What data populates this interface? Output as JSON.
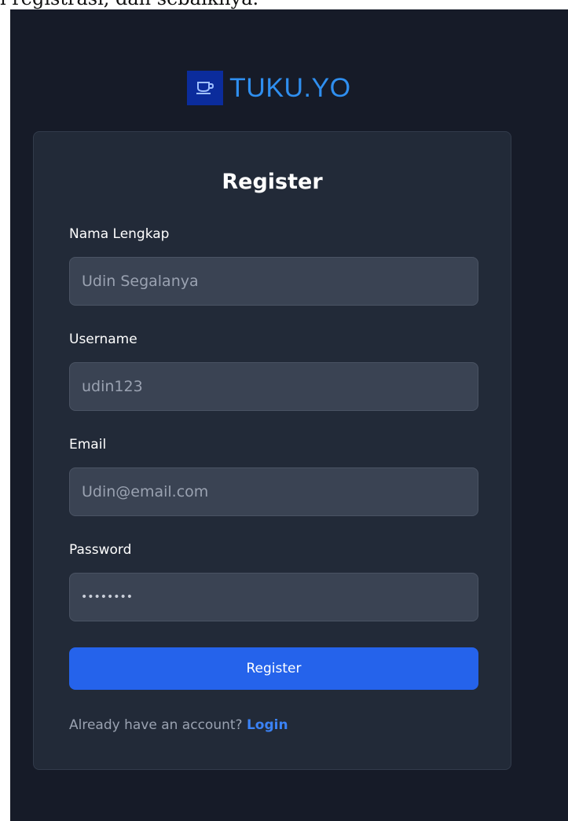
{
  "page_caption": "i registrasi, dan sebaiknya.",
  "brand": {
    "name": "TUKU.YO",
    "logo_icon": "coffee-cup-icon",
    "colors": {
      "logo_bg": "#0b2c9c",
      "name": "#2f8ff0"
    }
  },
  "form": {
    "title": "Register",
    "fields": [
      {
        "label": "Nama Lengkap",
        "placeholder": "Udin Segalanya",
        "value": ""
      },
      {
        "label": "Username",
        "placeholder": "udin123",
        "value": ""
      },
      {
        "label": "Email",
        "placeholder": "Udin@email.com",
        "value": ""
      },
      {
        "label": "Password",
        "placeholder": "",
        "value": "••••••••"
      }
    ],
    "submit_label": "Register",
    "footer_prompt": "Already have an account? ",
    "footer_link": "Login"
  },
  "colors": {
    "page_bg": "#161b28",
    "card_bg": "#222a38",
    "input_bg": "#3a4353",
    "accent": "#2563eb",
    "link": "#3b82f6"
  }
}
